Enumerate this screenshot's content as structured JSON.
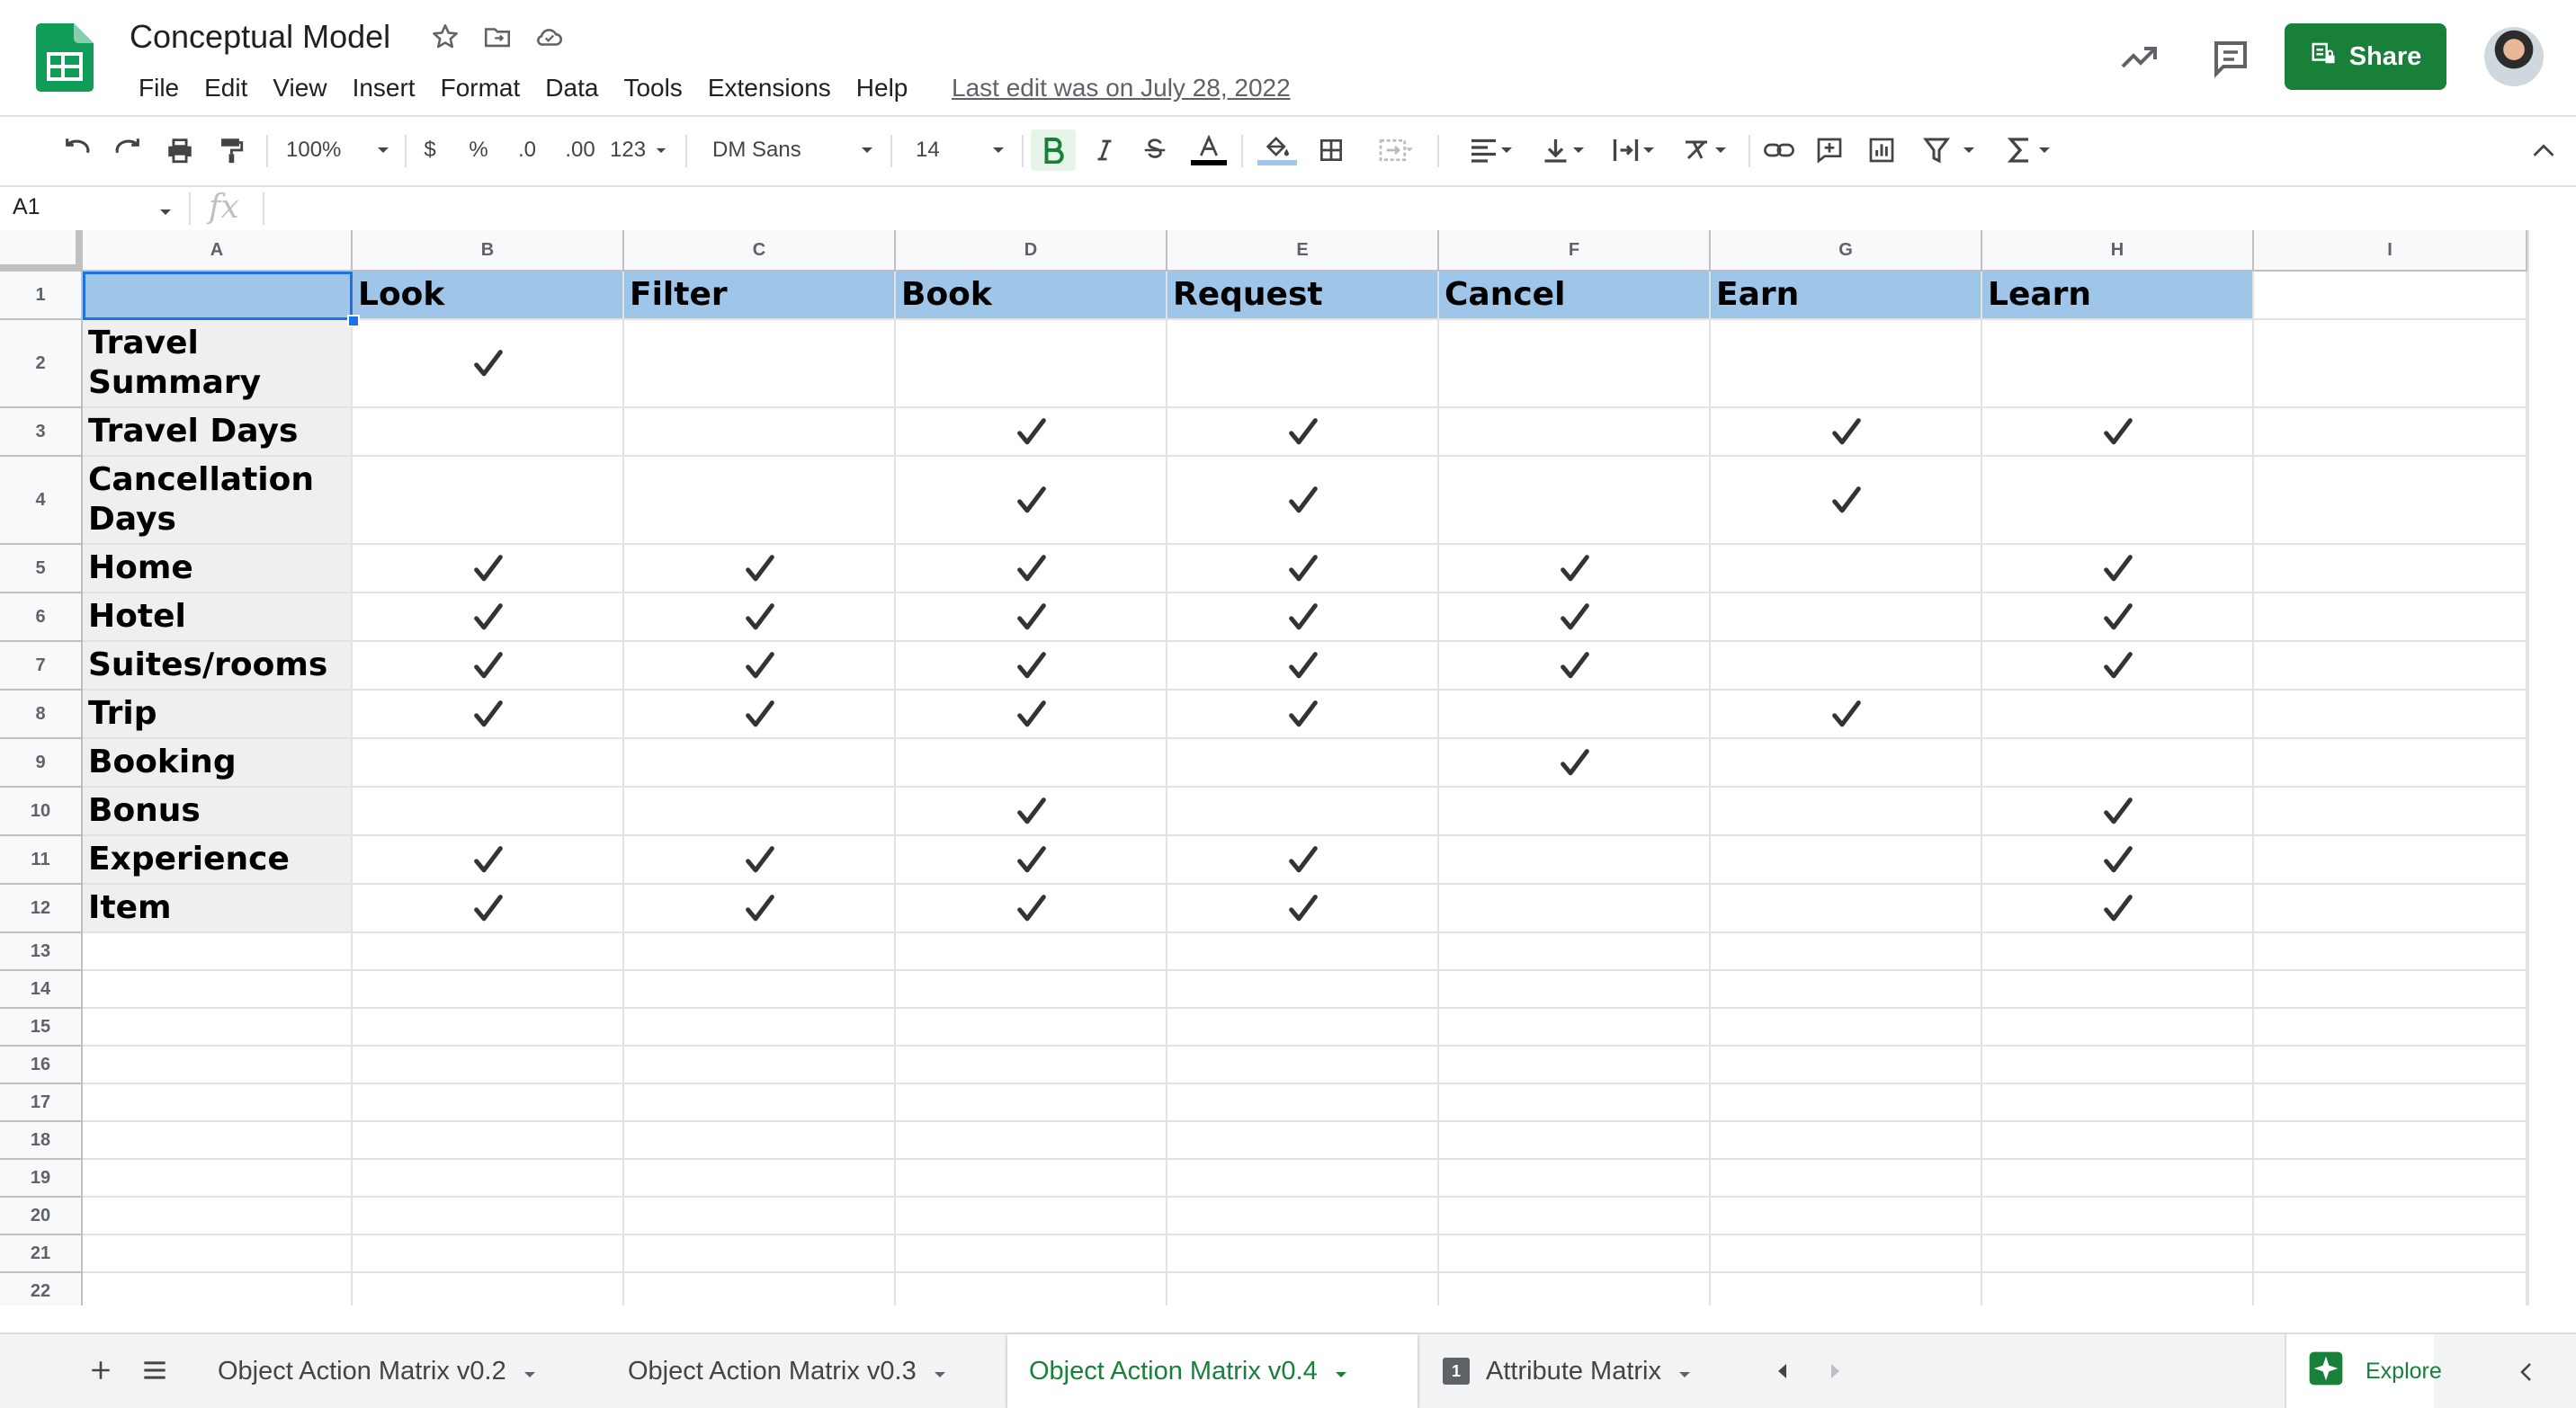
{
  "app": {
    "doc_title": "Conceptual Model",
    "menus": [
      "File",
      "Edit",
      "View",
      "Insert",
      "Format",
      "Data",
      "Tools",
      "Extensions",
      "Help"
    ],
    "last_edit": "Last edit was on July 28, 2022",
    "share_label": "Share",
    "accent": "#188038"
  },
  "toolbar": {
    "zoom": "100%",
    "currency": "$",
    "percent": "%",
    "dec_decrease": ".0",
    "dec_increase": ".00",
    "more_formats": "123",
    "font": "DM Sans",
    "font_size": "14"
  },
  "formula_bar": {
    "cell_ref": "A1",
    "fx": "fx"
  },
  "sheet": {
    "columns": [
      "A",
      "B",
      "C",
      "D",
      "E",
      "F",
      "G",
      "H",
      "I"
    ],
    "row_numbers": [
      "1",
      "2",
      "3",
      "4",
      "5",
      "6",
      "7",
      "8",
      "9",
      "10",
      "11",
      "12",
      "13",
      "14",
      "15",
      "16",
      "17",
      "18",
      "19",
      "20",
      "21",
      "22"
    ],
    "actions": [
      "Look",
      "Filter",
      "Book",
      "Request",
      "Cancel",
      "Earn",
      "Learn"
    ],
    "objects": [
      {
        "label": "Travel Summary",
        "checks": [
          1,
          0,
          0,
          0,
          0,
          0,
          0
        ]
      },
      {
        "label": "Travel Days",
        "checks": [
          0,
          0,
          1,
          1,
          0,
          1,
          1
        ]
      },
      {
        "label": "Cancellation Days",
        "checks": [
          0,
          0,
          1,
          1,
          0,
          1,
          0
        ]
      },
      {
        "label": "Home",
        "checks": [
          1,
          1,
          1,
          1,
          1,
          0,
          1
        ]
      },
      {
        "label": "Hotel",
        "checks": [
          1,
          1,
          1,
          1,
          1,
          0,
          1
        ]
      },
      {
        "label": "Suites/rooms",
        "checks": [
          1,
          1,
          1,
          1,
          1,
          0,
          1
        ]
      },
      {
        "label": "Trip",
        "checks": [
          1,
          1,
          1,
          1,
          0,
          1,
          0
        ]
      },
      {
        "label": "Booking",
        "checks": [
          0,
          0,
          0,
          0,
          1,
          0,
          0
        ]
      },
      {
        "label": "Bonus",
        "checks": [
          0,
          0,
          1,
          0,
          0,
          0,
          1
        ]
      },
      {
        "label": "Experience",
        "checks": [
          1,
          1,
          1,
          1,
          0,
          0,
          1
        ]
      },
      {
        "label": "Item",
        "checks": [
          1,
          1,
          1,
          1,
          0,
          0,
          1
        ]
      }
    ],
    "header_color": "#9fc5e8",
    "object_color": "#efefef"
  },
  "sheets": {
    "tabs": [
      {
        "label": "Object Action Matrix v0.2",
        "active": false
      },
      {
        "label": "Object Action Matrix v0.3",
        "active": false
      },
      {
        "label": "Object Action Matrix v0.4",
        "active": true
      },
      {
        "label": "Attribute Matrix",
        "active": false,
        "badge": "1"
      }
    ],
    "explore_label": "Explore"
  }
}
